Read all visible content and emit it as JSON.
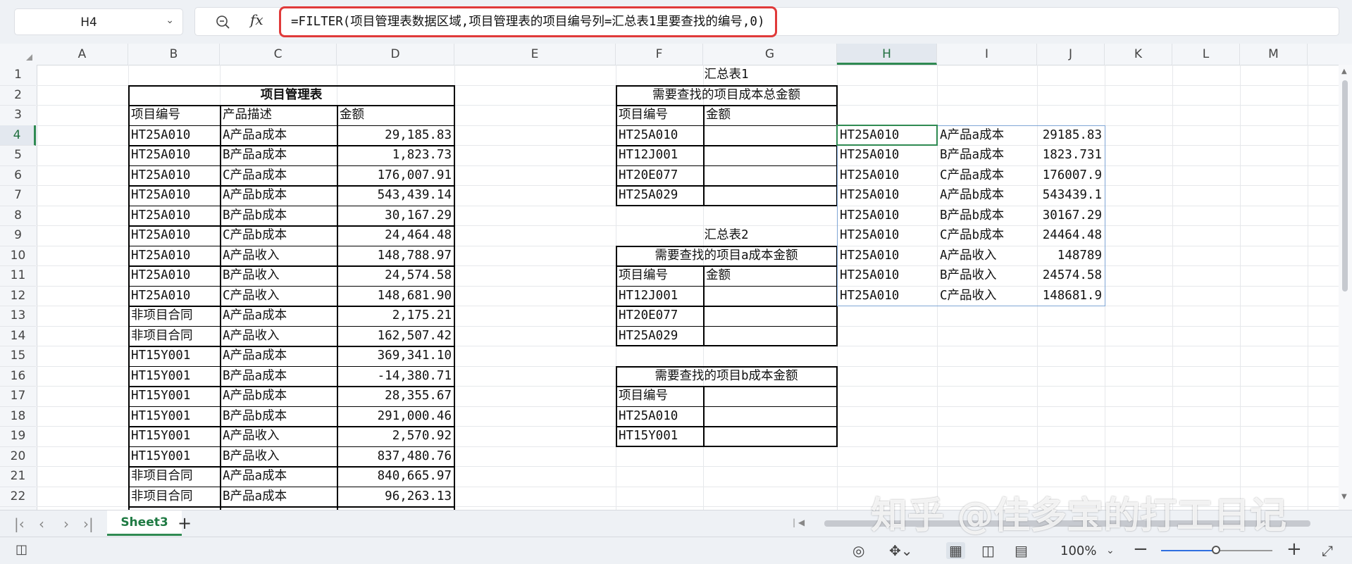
{
  "formula_bar": {
    "name_box": "H4",
    "formula": "=FILTER(项目管理表数据区域,项目管理表的项目编号列=汇总表1里要查找的编号,0)"
  },
  "columns": [
    "A",
    "B",
    "C",
    "D",
    "E",
    "F",
    "G",
    "H",
    "I",
    "J",
    "K",
    "L",
    "M"
  ],
  "rows": [
    "1",
    "2",
    "3",
    "4",
    "5",
    "6",
    "7",
    "8",
    "9",
    "10",
    "11",
    "12",
    "13",
    "14",
    "15",
    "16",
    "17",
    "18",
    "19",
    "20",
    "21",
    "22"
  ],
  "project_table": {
    "title": "项目管理表",
    "headers": [
      "项目编号",
      "产品描述",
      "金额"
    ],
    "rows": [
      [
        "HT25A010",
        "A产品a成本",
        "29,185.83"
      ],
      [
        "HT25A010",
        "B产品a成本",
        "1,823.73"
      ],
      [
        "HT25A010",
        "C产品a成本",
        "176,007.91"
      ],
      [
        "HT25A010",
        "A产品b成本",
        "543,439.14"
      ],
      [
        "HT25A010",
        "B产品b成本",
        "30,167.29"
      ],
      [
        "HT25A010",
        "C产品b成本",
        "24,464.48"
      ],
      [
        "HT25A010",
        "A产品收入",
        "148,788.97"
      ],
      [
        "HT25A010",
        "B产品收入",
        "24,574.58"
      ],
      [
        "HT25A010",
        "C产品收入",
        "148,681.90"
      ],
      [
        "非项目合同",
        "A产品a成本",
        "2,175.21"
      ],
      [
        "非项目合同",
        "A产品收入",
        "162,507.42"
      ],
      [
        "HT15Y001",
        "A产品a成本",
        "369,341.10"
      ],
      [
        "HT15Y001",
        "B产品a成本",
        "-14,380.71"
      ],
      [
        "HT15Y001",
        "A产品b成本",
        "28,355.67"
      ],
      [
        "HT15Y001",
        "B产品b成本",
        "291,000.46"
      ],
      [
        "HT15Y001",
        "A产品收入",
        "2,570.92"
      ],
      [
        "HT15Y001",
        "B产品收入",
        "837,480.76"
      ],
      [
        "非项目合同",
        "A产品a成本",
        "840,665.97"
      ],
      [
        "非项目合同",
        "B产品a成本",
        "96,263.13"
      ]
    ]
  },
  "summary1": {
    "title": "汇总表1",
    "subtitle": "需要查找的项目成本总金额",
    "headers": [
      "项目编号",
      "金额"
    ],
    "rows": [
      [
        "HT25A010",
        ""
      ],
      [
        "HT12J001",
        ""
      ],
      [
        "HT20E077",
        ""
      ],
      [
        "HT25A029",
        ""
      ]
    ]
  },
  "summary2": {
    "title": "汇总表2",
    "subtitle": "需要查找的项目a成本金额",
    "headers": [
      "项目编号",
      "金额"
    ],
    "rows": [
      [
        "HT12J001",
        ""
      ],
      [
        "HT20E077",
        ""
      ],
      [
        "HT25A029",
        ""
      ]
    ]
  },
  "summary3": {
    "subtitle": "需要查找的项目b成本金额",
    "headers": [
      "项目编号",
      ""
    ],
    "rows": [
      [
        "HT25A010",
        ""
      ],
      [
        "HT15Y001",
        ""
      ]
    ]
  },
  "filter_result": [
    [
      "HT25A010",
      "A产品a成本",
      "29185.83"
    ],
    [
      "HT25A010",
      "B产品a成本",
      "1823.731"
    ],
    [
      "HT25A010",
      "C产品a成本",
      "176007.9"
    ],
    [
      "HT25A010",
      "A产品b成本",
      "543439.1"
    ],
    [
      "HT25A010",
      "B产品b成本",
      "30167.29"
    ],
    [
      "HT25A010",
      "C产品b成本",
      "24464.48"
    ],
    [
      "HT25A010",
      "A产品收入",
      "148789"
    ],
    [
      "HT25A010",
      "B产品收入",
      "24574.58"
    ],
    [
      "HT25A010",
      "C产品收入",
      "148681.9"
    ]
  ],
  "sheet_tab": "Sheet3",
  "status": {
    "zoom": "100%"
  },
  "watermark": "知乎 @佳多宝的打工日记",
  "colors": {
    "accent": "#2f8a52",
    "highlight": "#e03a3a"
  }
}
